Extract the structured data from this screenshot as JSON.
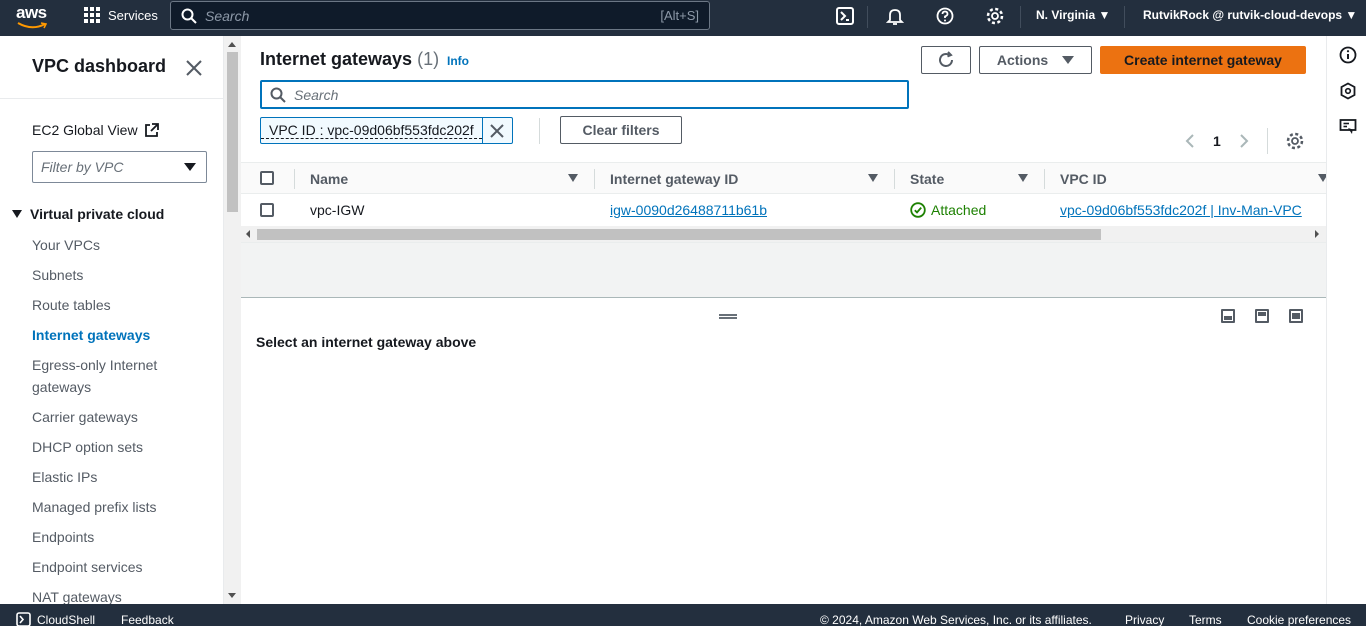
{
  "topbar": {
    "logo": "aws",
    "services_label": "Services",
    "search_placeholder": "Search",
    "search_shortcut": "[Alt+S]",
    "region": "N. Virginia",
    "account": "RutvikRock @ rutvik-cloud-devops",
    "icons": [
      "cloudshell-icon",
      "bell-icon",
      "help-icon",
      "gear-icon"
    ]
  },
  "sidenav": {
    "title": "VPC dashboard",
    "ec2_link": "EC2 Global View",
    "filter_placeholder": "Filter by VPC",
    "section": "Virtual private cloud",
    "items": [
      {
        "label": "Your VPCs"
      },
      {
        "label": "Subnets"
      },
      {
        "label": "Route tables"
      },
      {
        "label": "Internet gateways",
        "active": true
      },
      {
        "label": "Egress-only Internet gateways"
      },
      {
        "label": "Carrier gateways"
      },
      {
        "label": "DHCP option sets"
      },
      {
        "label": "Elastic IPs"
      },
      {
        "label": "Managed prefix lists"
      },
      {
        "label": "Endpoints"
      },
      {
        "label": "Endpoint services"
      },
      {
        "label": "NAT gateways"
      }
    ]
  },
  "main": {
    "title": "Internet gateways",
    "count": "(1)",
    "info": "Info",
    "actions_label": "Actions",
    "create_label": "Create internet gateway",
    "search_placeholder": "Search",
    "filter_token": "VPC ID : vpc-09d06bf553fdc202f",
    "clear_filters": "Clear filters",
    "page": "1",
    "columns": [
      "Name",
      "Internet gateway ID",
      "State",
      "VPC ID"
    ],
    "rows": [
      {
        "name": "vpc-IGW",
        "id": "igw-0090d26488711b61b",
        "state": "Attached",
        "vpc": "vpc-09d06bf553fdc202f | Inv-Man-VPC"
      }
    ],
    "detail_message": "Select an internet gateway above"
  },
  "footer": {
    "cloudshell": "CloudShell",
    "feedback": "Feedback",
    "copyright": "© 2024, Amazon Web Services, Inc. or its affiliates.",
    "privacy": "Privacy",
    "terms": "Terms",
    "cookies": "Cookie preferences"
  },
  "colors": {
    "topbar": "#232f3e",
    "accent_link": "#0073bb",
    "primary_button": "#ec7211",
    "success": "#1d8102"
  }
}
